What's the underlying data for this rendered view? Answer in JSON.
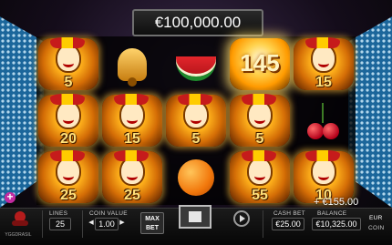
{
  "jackpot": {
    "amount": "€100,000.00"
  },
  "reels": [
    [
      {
        "symbol": "joker",
        "value": "5"
      },
      {
        "symbol": "joker",
        "value": "20"
      },
      {
        "symbol": "joker",
        "value": "25"
      }
    ],
    [
      {
        "symbol": "bell"
      },
      {
        "symbol": "joker",
        "value": "15"
      },
      {
        "symbol": "joker",
        "value": "25"
      }
    ],
    [
      {
        "symbol": "watermelon"
      },
      {
        "symbol": "joker",
        "value": "5"
      },
      {
        "symbol": "orange"
      }
    ],
    [
      {
        "symbol": "heart-joker",
        "value": "145"
      },
      {
        "symbol": "joker",
        "value": "5"
      },
      {
        "symbol": "joker",
        "value": "55"
      }
    ],
    [
      {
        "symbol": "joker",
        "value": "15"
      },
      {
        "symbol": "cherries"
      },
      {
        "symbol": "joker",
        "value": "10"
      }
    ]
  ],
  "win": {
    "text": "+ €155.00"
  },
  "controls": {
    "lines_label": "LINES",
    "lines_value": "25",
    "coin_value_label": "COIN VALUE",
    "coin_value": "1.00",
    "max_bet_label": "MAX BET",
    "cash_bet_label": "CASH BET",
    "cash_bet_value": "€25.00",
    "balance_label": "BALANCE",
    "balance_value": "€10,325.00",
    "currency_label": "EUR",
    "coin_label": "COIN",
    "logo_text": "YGGDRASIL"
  },
  "colors": {
    "gold": "#ffb21c",
    "side_lights": "#1d6fa8",
    "panel": "#111111"
  }
}
